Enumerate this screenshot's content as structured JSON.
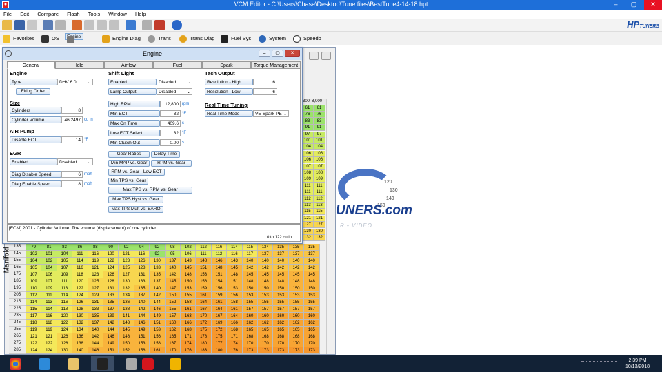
{
  "window": {
    "title": "VCM Editor - C:\\Users\\Chase\\Desktop\\Tune files\\BestTune4-14-18.hpt",
    "min": "–",
    "max": "▢",
    "close": "✕"
  },
  "menu": [
    "File",
    "Edit",
    "Compare",
    "Flash",
    "Tools",
    "Window",
    "Help"
  ],
  "nav": [
    "Favorites",
    "OS",
    "Engine",
    "Engine Diag",
    "Trans",
    "Trans Diag",
    "Fuel Sys",
    "System",
    "Speedo"
  ],
  "brand": "HP",
  "brand_sub": "TUNERS",
  "engine_window": {
    "title": "Engine",
    "tabs": [
      "General",
      "Idle",
      "Airflow",
      "Fuel",
      "Spark",
      "Torque Management"
    ],
    "engine": {
      "heading": "Engine",
      "type_label": "Type",
      "type_value": "DHV 6.0L",
      "firing_order": "Firing Order"
    },
    "size": {
      "heading": "Size",
      "cylinders_label": "Cylinders",
      "cylinders_value": "8",
      "volume_label": "Cylinder Volume",
      "volume_value": "46.2497",
      "volume_unit": "cu in"
    },
    "air_pump": {
      "heading": "AIR Pump",
      "disable_ect_label": "Disable ECT",
      "disable_ect_value": "14",
      "unit": "°F"
    },
    "egr": {
      "heading": "EGR",
      "enabled_label": "Enabled",
      "enabled_value": "Disabled",
      "disable_speed_label": "Diag Disable Speed",
      "disable_speed_value": "6",
      "enable_speed_label": "Diag Enable Speed",
      "enable_speed_value": "8",
      "unit": "mph"
    },
    "shift_light": {
      "heading": "Shift Light",
      "enabled_label": "Enabled",
      "enabled_value": "Disabled",
      "lamp_label": "Lamp Output",
      "lamp_value": "Disabled",
      "high_rpm_label": "High RPM",
      "high_rpm_value": "12,800",
      "rpm_unit": "rpm",
      "min_ect_label": "Min ECT",
      "min_ect_value": "32",
      "f_unit": "°F",
      "max_on_label": "Max On Time",
      "max_on_value": "409.6",
      "s_unit": "s",
      "low_ect_label": "Low ECT Select",
      "low_ect_value": "32",
      "min_clutch_label": "Min Clutch Out",
      "min_clutch_value": "0.00",
      "buttons": [
        "Gear Ratios",
        "Delay Time",
        "Min MAP vs. Gear",
        "RPM vs. Gear",
        "RPM vs. Gear - Low ECT",
        "Min TPS vs. Gear",
        "Max TPS vs. RPM vs. Gear",
        "Max TPS Hyst vs. Gear",
        "Max TPS Mult vs. BARO"
      ]
    },
    "tach": {
      "heading": "Tach Output",
      "res_high_label": "Resolution - High",
      "res_high_value": "6",
      "res_low_label": "Resolution - Low",
      "res_low_value": "6"
    },
    "rtt": {
      "heading": "Real Time Tuning",
      "mode_label": "Real Time Mode",
      "mode_value": "VE-Spark-PE"
    },
    "status": "[ECM] 2001 - Cylinder Volume: The volume (displacement) of one cylinder.",
    "range": "0 to 122 cu in"
  },
  "table": {
    "axis_label": "Manifold",
    "col_header_a": "300",
    "col_header_b": "8,000",
    "right_cols": [
      [
        "61",
        "61"
      ],
      [
        "76",
        "76"
      ],
      [
        "83",
        "83"
      ],
      [
        "91",
        "91"
      ],
      [
        "97",
        "97"
      ],
      [
        "101",
        "101"
      ],
      [
        "104",
        "104"
      ],
      [
        "106",
        "106"
      ],
      [
        "106",
        "106"
      ],
      [
        "107",
        "107"
      ],
      [
        "108",
        "108"
      ],
      [
        "109",
        "109"
      ],
      [
        "111",
        "111"
      ],
      [
        "111",
        "111"
      ],
      [
        "112",
        "112"
      ],
      [
        "113",
        "113"
      ],
      [
        "115",
        "115"
      ],
      [
        "121",
        "121"
      ],
      [
        "127",
        "127"
      ],
      [
        "130",
        "130"
      ],
      [
        "132",
        "132"
      ]
    ],
    "rows": [
      {
        "k": "135",
        "v": [
          "79",
          "81",
          "83",
          "86",
          "88",
          "90",
          "92",
          "94",
          "92",
          "98",
          "102",
          "112",
          "116",
          "114",
          "115",
          "134",
          "135",
          "135",
          "135"
        ]
      },
      {
        "k": "145",
        "v": [
          "102",
          "101",
          "104",
          "111",
          "116",
          "120",
          "121",
          "116",
          "92",
          "95",
          "106",
          "111",
          "112",
          "116",
          "117",
          "137",
          "137",
          "137",
          "137"
        ]
      },
      {
        "k": "155",
        "v": [
          "104",
          "102",
          "105",
          "114",
          "119",
          "122",
          "123",
          "126",
          "130",
          "137",
          "143",
          "148",
          "146",
          "143",
          "140",
          "140",
          "140",
          "140",
          "140"
        ]
      },
      {
        "k": "165",
        "v": [
          "105",
          "104",
          "107",
          "116",
          "121",
          "124",
          "125",
          "128",
          "133",
          "140",
          "145",
          "151",
          "148",
          "145",
          "142",
          "142",
          "142",
          "142",
          "142"
        ]
      },
      {
        "k": "175",
        "v": [
          "107",
          "106",
          "109",
          "118",
          "123",
          "126",
          "127",
          "131",
          "135",
          "142",
          "148",
          "153",
          "151",
          "148",
          "145",
          "145",
          "145",
          "145",
          "145"
        ]
      },
      {
        "k": "185",
        "v": [
          "109",
          "107",
          "111",
          "120",
          "125",
          "128",
          "130",
          "133",
          "137",
          "145",
          "150",
          "156",
          "154",
          "151",
          "148",
          "148",
          "148",
          "148",
          "148"
        ]
      },
      {
        "k": "195",
        "v": [
          "110",
          "109",
          "113",
          "122",
          "127",
          "131",
          "132",
          "135",
          "140",
          "147",
          "153",
          "159",
          "156",
          "153",
          "150",
          "150",
          "150",
          "150",
          "150"
        ]
      },
      {
        "k": "205",
        "v": [
          "112",
          "111",
          "114",
          "124",
          "129",
          "133",
          "134",
          "137",
          "142",
          "150",
          "155",
          "161",
          "159",
          "156",
          "153",
          "153",
          "153",
          "153",
          "153"
        ]
      },
      {
        "k": "215",
        "v": [
          "114",
          "113",
          "116",
          "126",
          "131",
          "135",
          "136",
          "140",
          "144",
          "152",
          "158",
          "164",
          "161",
          "158",
          "155",
          "155",
          "155",
          "155",
          "155"
        ]
      },
      {
        "k": "225",
        "v": [
          "115",
          "114",
          "118",
          "128",
          "133",
          "137",
          "138",
          "142",
          "146",
          "155",
          "161",
          "167",
          "164",
          "161",
          "157",
          "157",
          "157",
          "157",
          "157"
        ]
      },
      {
        "k": "235",
        "v": [
          "117",
          "116",
          "120",
          "130",
          "135",
          "139",
          "141",
          "144",
          "149",
          "157",
          "163",
          "170",
          "167",
          "164",
          "160",
          "160",
          "160",
          "160",
          "160"
        ]
      },
      {
        "k": "245",
        "v": [
          "118",
          "118",
          "122",
          "132",
          "137",
          "142",
          "143",
          "146",
          "151",
          "160",
          "166",
          "172",
          "169",
          "166",
          "162",
          "162",
          "162",
          "162",
          "162"
        ]
      },
      {
        "k": "255",
        "v": [
          "119",
          "119",
          "124",
          "134",
          "140",
          "144",
          "145",
          "149",
          "153",
          "162",
          "168",
          "175",
          "172",
          "168",
          "165",
          "165",
          "165",
          "165",
          "165"
        ]
      },
      {
        "k": "265",
        "v": [
          "121",
          "121",
          "126",
          "136",
          "142",
          "146",
          "148",
          "151",
          "156",
          "165",
          "171",
          "178",
          "175",
          "171",
          "168",
          "168",
          "168",
          "168",
          "168"
        ]
      },
      {
        "k": "275",
        "v": [
          "122",
          "122",
          "128",
          "138",
          "144",
          "149",
          "150",
          "153",
          "158",
          "167",
          "174",
          "180",
          "177",
          "174",
          "170",
          "170",
          "170",
          "170",
          "170"
        ]
      },
      {
        "k": "285",
        "v": [
          "124",
          "124",
          "130",
          "140",
          "146",
          "151",
          "152",
          "156",
          "161",
          "170",
          "176",
          "183",
          "180",
          "176",
          "173",
          "173",
          "173",
          "173",
          "173"
        ]
      }
    ]
  },
  "logo": {
    "text": "UNERS.com",
    "sub": "R • VIDEO",
    "g1": "120",
    "g2": "130",
    "g3": "140",
    "g4": "150"
  },
  "clock": {
    "time": "2:39 PM",
    "date": "10/13/2018"
  }
}
